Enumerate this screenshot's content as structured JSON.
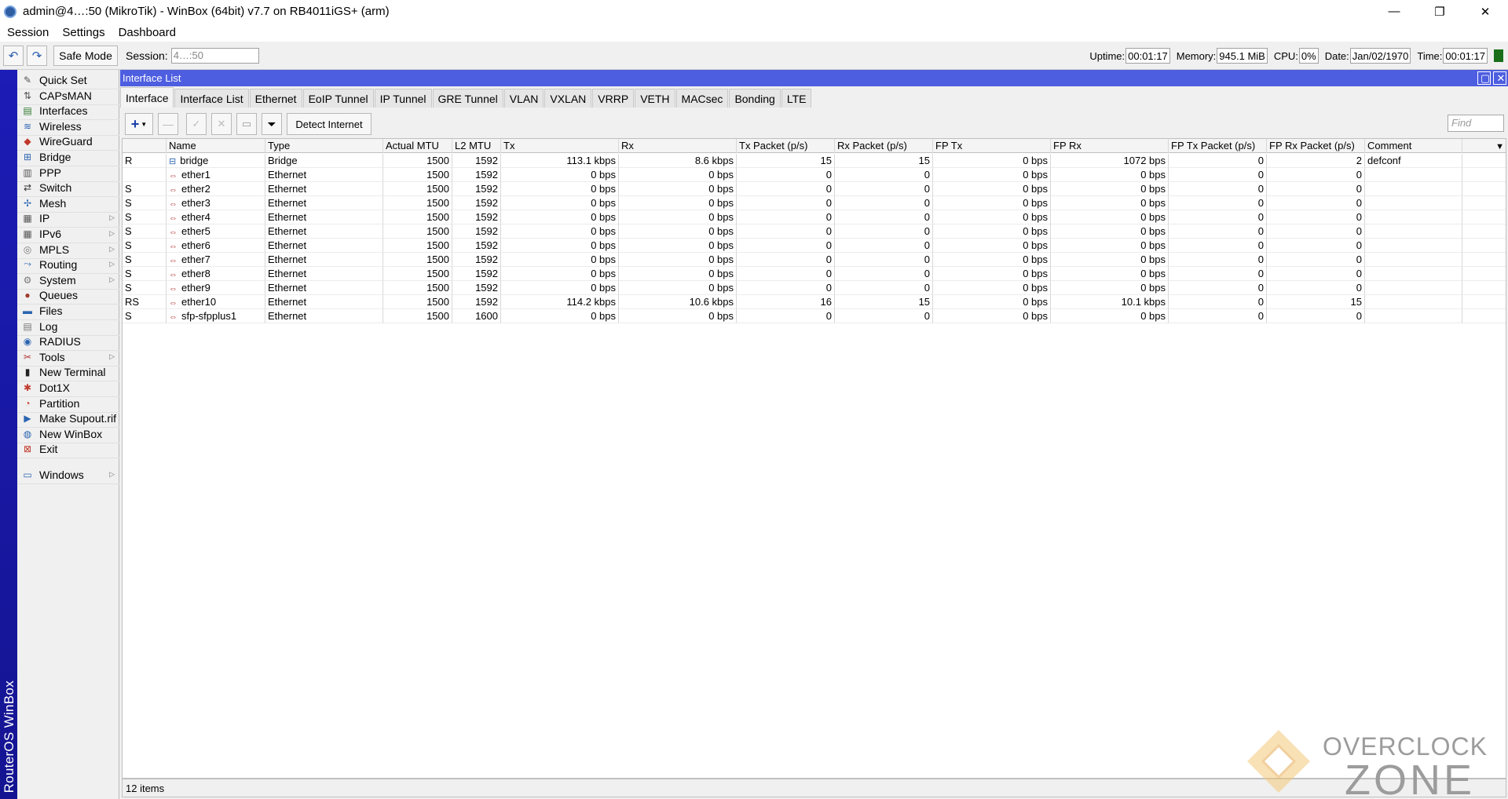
{
  "titlebar": {
    "title": "admin@4…:50 (MikroTik) - WinBox (64bit) v7.7 on RB4011iGS+ (arm)",
    "buttons": [
      "—",
      "❐",
      "✕"
    ]
  },
  "menu": [
    "Session",
    "Settings",
    "Dashboard"
  ],
  "toolbar": {
    "safe_mode": "Safe Mode",
    "session_label": "Session:",
    "session_value": "4…:50",
    "uptime_label": "Uptime:",
    "uptime": "00:01:17",
    "memory_label": "Memory:",
    "memory": "945.1 MiB",
    "cpu_label": "CPU:",
    "cpu": "0%",
    "date_label": "Date:",
    "date": "Jan/02/1970",
    "time_label": "Time:",
    "time": "00:01:17"
  },
  "sidestrip": "RouterOS WinBox",
  "sidebar": [
    {
      "label": "Quick Set",
      "icon": "wand-icon",
      "sub": false
    },
    {
      "label": "CAPsMAN",
      "icon": "capsman-icon",
      "sub": false
    },
    {
      "label": "Interfaces",
      "icon": "interfaces-icon",
      "sub": false
    },
    {
      "label": "Wireless",
      "icon": "wireless-icon",
      "sub": false
    },
    {
      "label": "WireGuard",
      "icon": "wireguard-icon",
      "sub": false
    },
    {
      "label": "Bridge",
      "icon": "bridge-icon",
      "sub": false
    },
    {
      "label": "PPP",
      "icon": "ppp-icon",
      "sub": false
    },
    {
      "label": "Switch",
      "icon": "switch-icon",
      "sub": false
    },
    {
      "label": "Mesh",
      "icon": "mesh-icon",
      "sub": false
    },
    {
      "label": "IP",
      "icon": "ip-icon",
      "sub": true
    },
    {
      "label": "IPv6",
      "icon": "ipv6-icon",
      "sub": true
    },
    {
      "label": "MPLS",
      "icon": "mpls-icon",
      "sub": true
    },
    {
      "label": "Routing",
      "icon": "routing-icon",
      "sub": true
    },
    {
      "label": "System",
      "icon": "system-icon",
      "sub": true
    },
    {
      "label": "Queues",
      "icon": "queues-icon",
      "sub": false
    },
    {
      "label": "Files",
      "icon": "files-icon",
      "sub": false
    },
    {
      "label": "Log",
      "icon": "log-icon",
      "sub": false
    },
    {
      "label": "RADIUS",
      "icon": "radius-icon",
      "sub": false
    },
    {
      "label": "Tools",
      "icon": "tools-icon",
      "sub": true
    },
    {
      "label": "New Terminal",
      "icon": "terminal-icon",
      "sub": false
    },
    {
      "label": "Dot1X",
      "icon": "dot1x-icon",
      "sub": false
    },
    {
      "label": "Partition",
      "icon": "partition-icon",
      "sub": false
    },
    {
      "label": "Make Supout.rif",
      "icon": "supout-icon",
      "sub": false
    },
    {
      "label": "New WinBox",
      "icon": "winbox-icon",
      "sub": false
    },
    {
      "label": "Exit",
      "icon": "exit-icon",
      "sub": false
    },
    {
      "label": "Windows",
      "icon": "windows-icon",
      "sub": true
    }
  ],
  "window": {
    "title": "Interface List",
    "tabs": [
      "Interface",
      "Interface List",
      "Ethernet",
      "EoIP Tunnel",
      "IP Tunnel",
      "GRE Tunnel",
      "VLAN",
      "VXLAN",
      "VRRP",
      "VETH",
      "MACsec",
      "Bonding",
      "LTE"
    ],
    "active_tab": "Interface",
    "detect_internet": "Detect Internet",
    "find_placeholder": "Find",
    "columns": [
      "",
      "Name",
      "Type",
      "Actual MTU",
      "L2 MTU",
      "Tx",
      "Rx",
      "Tx Packet (p/s)",
      "Rx Packet (p/s)",
      "FP Tx",
      "FP Rx",
      "FP Tx Packet (p/s)",
      "FP Rx Packet (p/s)",
      "Comment"
    ],
    "rows": [
      [
        "R",
        "bridge",
        "Bridge",
        "1500",
        "1592",
        "113.1 kbps",
        "8.6 kbps",
        "15",
        "15",
        "0 bps",
        "1072 bps",
        "0",
        "2",
        "defconf"
      ],
      [
        "",
        "ether1",
        "Ethernet",
        "1500",
        "1592",
        "0 bps",
        "0 bps",
        "0",
        "0",
        "0 bps",
        "0 bps",
        "0",
        "0",
        ""
      ],
      [
        "S",
        "ether2",
        "Ethernet",
        "1500",
        "1592",
        "0 bps",
        "0 bps",
        "0",
        "0",
        "0 bps",
        "0 bps",
        "0",
        "0",
        ""
      ],
      [
        "S",
        "ether3",
        "Ethernet",
        "1500",
        "1592",
        "0 bps",
        "0 bps",
        "0",
        "0",
        "0 bps",
        "0 bps",
        "0",
        "0",
        ""
      ],
      [
        "S",
        "ether4",
        "Ethernet",
        "1500",
        "1592",
        "0 bps",
        "0 bps",
        "0",
        "0",
        "0 bps",
        "0 bps",
        "0",
        "0",
        ""
      ],
      [
        "S",
        "ether5",
        "Ethernet",
        "1500",
        "1592",
        "0 bps",
        "0 bps",
        "0",
        "0",
        "0 bps",
        "0 bps",
        "0",
        "0",
        ""
      ],
      [
        "S",
        "ether6",
        "Ethernet",
        "1500",
        "1592",
        "0 bps",
        "0 bps",
        "0",
        "0",
        "0 bps",
        "0 bps",
        "0",
        "0",
        ""
      ],
      [
        "S",
        "ether7",
        "Ethernet",
        "1500",
        "1592",
        "0 bps",
        "0 bps",
        "0",
        "0",
        "0 bps",
        "0 bps",
        "0",
        "0",
        ""
      ],
      [
        "S",
        "ether8",
        "Ethernet",
        "1500",
        "1592",
        "0 bps",
        "0 bps",
        "0",
        "0",
        "0 bps",
        "0 bps",
        "0",
        "0",
        ""
      ],
      [
        "S",
        "ether9",
        "Ethernet",
        "1500",
        "1592",
        "0 bps",
        "0 bps",
        "0",
        "0",
        "0 bps",
        "0 bps",
        "0",
        "0",
        ""
      ],
      [
        "RS",
        "ether10",
        "Ethernet",
        "1500",
        "1592",
        "114.2 kbps",
        "10.6 kbps",
        "16",
        "15",
        "0 bps",
        "10.1 kbps",
        "0",
        "15",
        ""
      ],
      [
        "S",
        "sfp-sfpplus1",
        "Ethernet",
        "1500",
        "1600",
        "0 bps",
        "0 bps",
        "0",
        "0",
        "0 bps",
        "0 bps",
        "0",
        "0",
        ""
      ]
    ],
    "item_count": "12 items"
  },
  "watermark": {
    "line1": "OVERCLOCK",
    "line2": "ZONE"
  },
  "colors": {
    "sidestrip": "#1c1cb6",
    "window_title": "#4d5ee0",
    "cpu_indicator": "#1a6e1a"
  }
}
